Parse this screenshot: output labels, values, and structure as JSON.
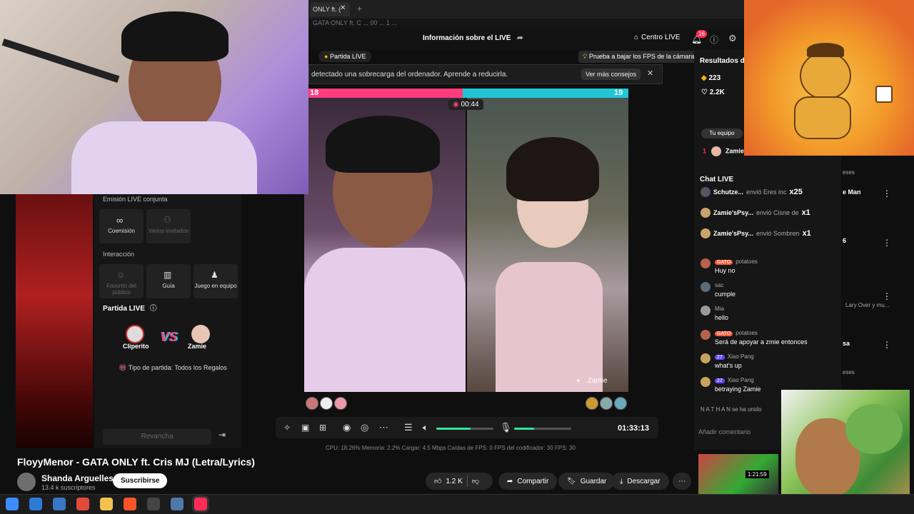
{
  "browser": {
    "tab_label": "ONLY ft. (",
    "address_fragment": "GATA ONLY ft. C ... 00 ... 1 ..."
  },
  "studio": {
    "header_title": "Información sobre el LIVE",
    "centro_live": "Centro LIVE",
    "notifications": "16",
    "partida_pill": "Partida LIVE",
    "fps_tip": "Prueba a bajar los FPS de la cámara",
    "warning": "detectado una sobrecarga del ordenador. Aprende a reducirla.",
    "warning_button": "Ver más consejos",
    "battle": {
      "score_left": "18",
      "score_right": "19",
      "timer": "00:44",
      "right_name": "Zamie"
    },
    "controls": {
      "time": "01:33:13",
      "volume_level": 0.6,
      "mic_level": 0.35
    },
    "stats": "CPU: 18.26%     Memoria: 2.2%     Cargar: 4.5 Mbps     Caídas de FPS: 0     FPS del codificador: 30     FPS: 30"
  },
  "left_panel": {
    "section_joint": "Emisión LIVE conjunta",
    "tools_joint": [
      {
        "label": "Coemisión",
        "icon": "link-icon",
        "dim": false
      },
      {
        "label": "Varios invitados",
        "icon": "group-icon",
        "dim": true
      }
    ],
    "section_interaction": "Interacción",
    "tools_interaction": [
      {
        "label": "Favorito del público",
        "icon": "user-icon",
        "dim": true
      },
      {
        "label": "Guía",
        "icon": "book-icon",
        "dim": false
      },
      {
        "label": "Juego en equipo",
        "icon": "gamepad-icon",
        "dim": false
      }
    ],
    "partida_title": "Partida LIVE",
    "player_left": "Cliperito",
    "vs": "VS",
    "player_right": "Zamie",
    "tipo_partida": "Tipo de partida: Todos los Regalos",
    "revancha": "Revancha"
  },
  "right_panel": {
    "results_title": "Resultados de",
    "stat_1": "223",
    "stat_2": "2.2K",
    "team_label": "Tu equipo",
    "rank_name": "Zamie",
    "chat_title": "Chat LIVE",
    "gifts": [
      {
        "name": "Schutze...",
        "action": "envió Eres inc",
        "count": "x25"
      },
      {
        "name": "Zamie'sPsy...",
        "action": "envió Cisne de",
        "count": "x1"
      },
      {
        "name": "Zamie'sPsy...",
        "action": "envió Sombren",
        "count": "x1"
      }
    ],
    "messages": [
      {
        "badge": "GATO",
        "user": "potatoes",
        "text": "Huy no",
        "color": "#b5624e"
      },
      {
        "badge": "",
        "user": "sac",
        "text": "cumple",
        "color": "#5a6b7a"
      },
      {
        "badge": "",
        "user": "Mia",
        "text": "hello",
        "color": "#999"
      },
      {
        "badge": "GATO",
        "user": "potatoes",
        "text": "Será de apoyar a zmie entonces",
        "color": "#b5624e"
      },
      {
        "badge": "27",
        "user": "Xiao Pang",
        "text": "what's up",
        "color": "#c7a35d"
      },
      {
        "badge": "27",
        "user": "Xiao Pang",
        "text": "betraying Zamie",
        "color": "#c7a35d"
      }
    ],
    "join_notice": "N A T H A N   se ha unido",
    "chat_placeholder": "Añadir comentario"
  },
  "youtube": {
    "video_title": "FloyyMenor - GATA ONLY ft. Cris MJ (Letra/Lyrics)",
    "channel": "Shanda Arguelles",
    "subscribers": "13.4 k suscriptores",
    "subscribe": "Suscribirse",
    "likes": "1.2 K",
    "share": "Compartir",
    "save": "Guardar",
    "download": "Descargar",
    "thumb_duration": "1:21:59",
    "sidebar_texts": [
      "eses",
      "e Man",
      "6",
      "Lary Over y mu...",
      "sa",
      "eses"
    ]
  },
  "taskbar": {
    "icons": [
      "windows-icon",
      "edge-icon",
      "store-icon",
      "chrome-icon",
      "folder-icon",
      "brave-icon",
      "obs-icon",
      "app-icon",
      "tiktok-icon"
    ]
  }
}
